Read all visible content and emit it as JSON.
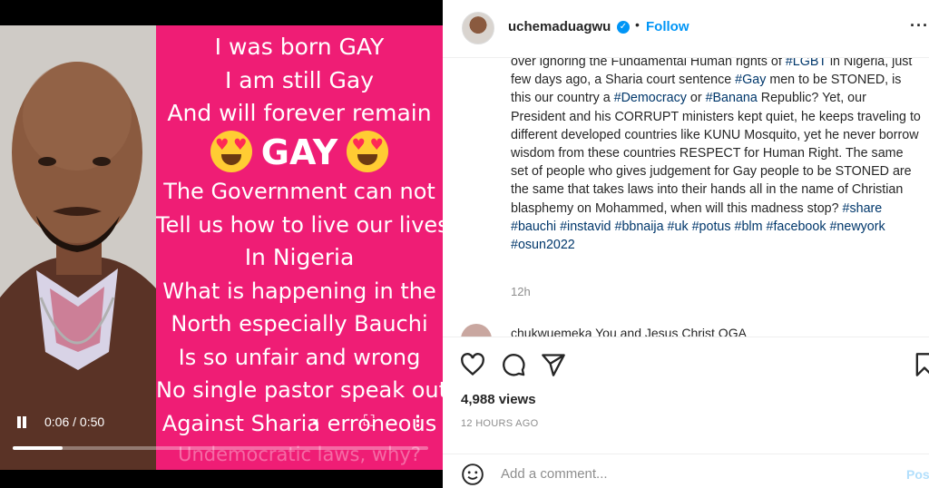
{
  "video": {
    "overlay_lines": [
      "I was born GAY",
      "I am still Gay",
      "And will forever remain",
      "GAY",
      "The Government can not",
      "Tell us how to live our lives",
      "In Nigeria",
      "What is happening in the",
      "North especially Bauchi",
      "Is so unfair and wrong",
      "No single pastor speak out",
      "Against Sharia erroneous",
      "Undemocratic laws, why?"
    ],
    "time_display": "0:06 / 0:50",
    "progress_fraction": 0.12
  },
  "post": {
    "username": "uchemaduagwu",
    "follow_label": "Follow",
    "dot": "•",
    "caption_segments": [
      {
        "t": "over ignoring the Fundamental Human rights of "
      },
      {
        "t": "#LGBT",
        "tag": true
      },
      {
        "t": " in Nigeria, just few days ago, a Sharia court sentence "
      },
      {
        "t": "#Gay",
        "tag": true
      },
      {
        "t": " men to be STONED, is this our country a "
      },
      {
        "t": "#Democracy",
        "tag": true
      },
      {
        "t": " or "
      },
      {
        "t": "#Banana",
        "tag": true
      },
      {
        "t": " Republic? Yet, our President and his CORRUPT ministers kept quiet, he keeps traveling to different developed countries like KUNU Mosquito, yet he never borrow wisdom from these countries RESPECT for Human Right. The same set of people who gives judgement for Gay people to be STONED are the same that takes laws into their hands all in the name of Christian blasphemy on Mohammed, when will this madness stop? "
      },
      {
        "t": "#share",
        "tag": true
      },
      {
        "t": " "
      },
      {
        "t": "#bauchi",
        "tag": true
      },
      {
        "t": " "
      },
      {
        "t": "#instavid",
        "tag": true
      },
      {
        "t": " "
      },
      {
        "t": "#bbnaija",
        "tag": true
      },
      {
        "t": " "
      },
      {
        "t": "#uk",
        "tag": true
      },
      {
        "t": " "
      },
      {
        "t": "#potus",
        "tag": true
      },
      {
        "t": " "
      },
      {
        "t": "#blm",
        "tag": true
      },
      {
        "t": " "
      },
      {
        "t": "#facebook",
        "tag": true
      },
      {
        "t": " "
      },
      {
        "t": "#newyork",
        "tag": true
      },
      {
        "t": " "
      },
      {
        "t": "#osun2022",
        "tag": true
      }
    ],
    "caption_age": "12h",
    "comment_peek": "chukwuemeka  You and Jesus Christ OGA",
    "views": "4,988 views",
    "posted_ago": "12 HOURS AGO",
    "comment_placeholder": "Add a comment...",
    "post_label": "Post"
  },
  "colors": {
    "pink": "#ef1d75",
    "link": "#0095f6",
    "hashtag": "#00376b"
  }
}
